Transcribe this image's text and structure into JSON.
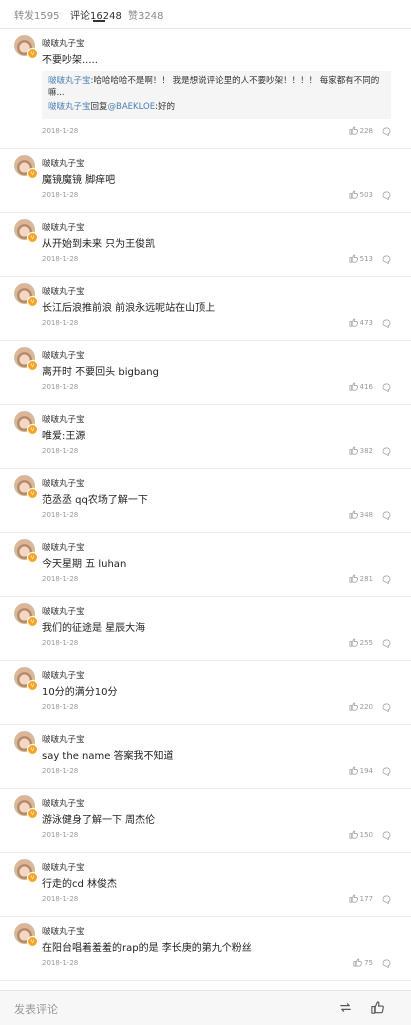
{
  "tabs": [
    {
      "label": "转发1595",
      "active": false
    },
    {
      "label": "评论16248",
      "active": true
    },
    {
      "label": "赞3248",
      "active": false
    }
  ],
  "first_comment": {
    "username": "啵啵丸子宝",
    "text": "不要吵架.....",
    "reply_1_user": "啵啵丸子宝",
    "reply_1_text": ":哈哈哈哈不是啊！！ 我是想说评论里的人不要吵架！！！！ 每家都有不同的嘛...",
    "reply_2_user": "啵啵丸子宝",
    "reply_2_mid": "回复",
    "reply_2_mention": "@BAEKLOE",
    "reply_2_text": ":好的",
    "date": "2018-1-28",
    "likes": "228"
  },
  "comments": [
    {
      "username": "啵啵丸子宝",
      "text": "魔镜魔镜 脚痒吧",
      "date": "2018-1-28",
      "likes": "503"
    },
    {
      "username": "啵啵丸子宝",
      "text": "从开始到未来 只为王俊凯",
      "date": "2018-1-28",
      "likes": "513"
    },
    {
      "username": "啵啵丸子宝",
      "text": "长江后浪推前浪 前浪永远呢站在山顶上",
      "date": "2018-1-28",
      "likes": "473"
    },
    {
      "username": "啵啵丸子宝",
      "text": "离开时 不要回头 bigbang",
      "date": "2018-1-28",
      "likes": "416"
    },
    {
      "username": "啵啵丸子宝",
      "text": "唯爱:王源",
      "date": "2018-1-28",
      "likes": "382"
    },
    {
      "username": "啵啵丸子宝",
      "text": "范丞丞 qq农场了解一下",
      "date": "2018-1-28",
      "likes": "348"
    },
    {
      "username": "啵啵丸子宝",
      "text": "今天星期 五 luhan",
      "date": "2018-1-28",
      "likes": "281"
    },
    {
      "username": "啵啵丸子宝",
      "text": "我们的征途是 星辰大海",
      "date": "2018-1-28",
      "likes": "255"
    },
    {
      "username": "啵啵丸子宝",
      "text": "10分的满分10分",
      "date": "2018-1-28",
      "likes": "220"
    },
    {
      "username": "啵啵丸子宝",
      "text": "say the name 答案我不知道",
      "date": "2018-1-28",
      "likes": "194"
    },
    {
      "username": "啵啵丸子宝",
      "text": "游泳健身了解一下 周杰伦",
      "date": "2018-1-28",
      "likes": "150"
    },
    {
      "username": "啵啵丸子宝",
      "text": "行走的cd 林俊杰",
      "date": "2018-1-28",
      "likes": "177"
    },
    {
      "username": "啵啵丸子宝",
      "text": "在阳台唱着羞羞的rap的是 李长庚的第九个粉丝",
      "date": "2018-1-28",
      "likes": "75"
    }
  ],
  "bottom_bar": {
    "placeholder": "发表评论",
    "icons": [
      "repost-icon",
      "like-icon"
    ]
  },
  "colors": {
    "link": "#4a7fb5",
    "verified_badge": "#f5a623"
  }
}
